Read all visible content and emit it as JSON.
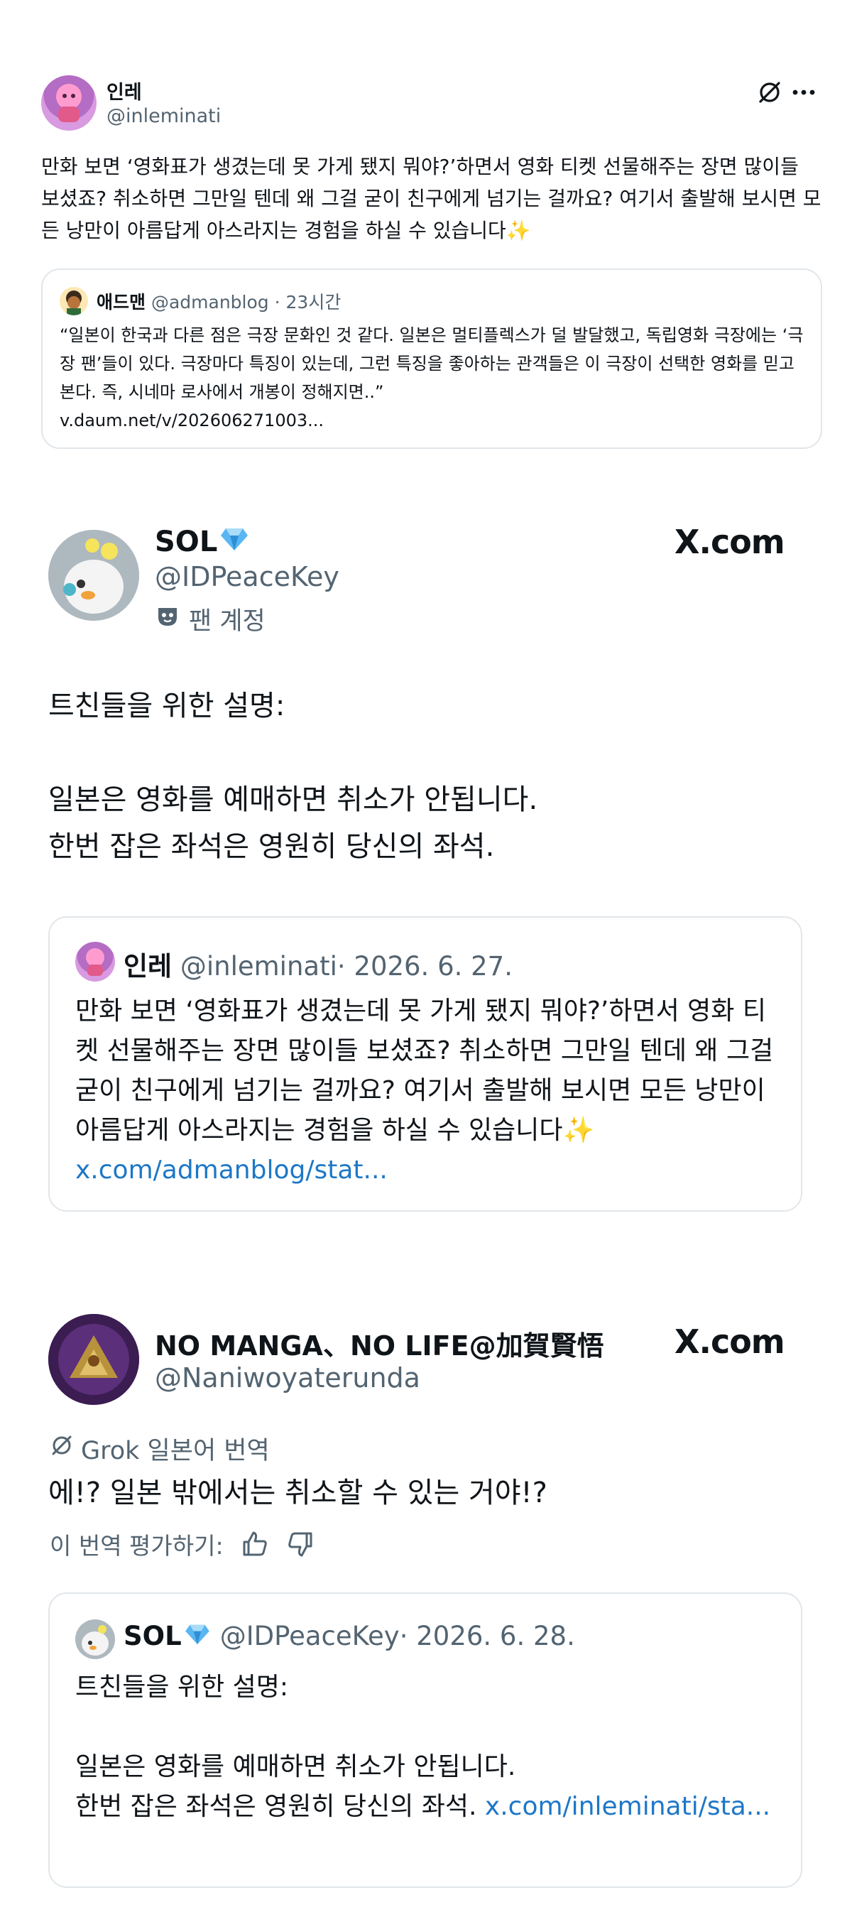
{
  "post1": {
    "name": "인레",
    "handle": "@inleminati",
    "body": "만화 보면 ‘영화표가 생겼는데 못 가게 됐지 뭐야?’하면서 영화 티켓 선물해주는 장면 많이들 보셨죠? 취소하면 그만일 텐데 왜 그걸 굳이 친구에게 넘기는 걸까요? 여기서 출발해 보시면 모든 낭만이 아름답게 아스라지는 경험을 하실 수 있습니다✨",
    "quote": {
      "name": "애드맨",
      "handle": "@admanblog",
      "time": "· 23시간",
      "text": "“일본이 한국과 다른 점은 극장 문화인 것 같다. 일본은 멀티플렉스가 덜 발달했고, 독립영화 극장에는 ‘극장 팬’들이 있다. 극장마다 특징이 있는데, 그런 특징을 좋아하는 관객들은 이 극장이 선택한 영화를 믿고 본다. 즉, 시네마 로사에서 개봉이 정해지면..”",
      "url": "v.daum.net/v/202606271003..."
    }
  },
  "post2": {
    "name": "SOL",
    "handle": "@IDPeaceKey",
    "badge": "팬 계정",
    "source": "X.com",
    "body_line1": "트친들을 위한 설명:",
    "body_line2": "일본은 영화를 예매하면 취소가 안됩니다.",
    "body_line3": "한번 잡은 좌석은 영원히 당신의 좌석.",
    "quote": {
      "name": "인레",
      "handle": "@inleminati",
      "date": "· 2026. 6. 27.",
      "text": "만화 보면 ‘영화표가 생겼는데 못 가게 됐지 뭐야?’하면서 영화 티켓 선물해주는 장면 많이들 보셨죠? 취소하면 그만일 텐데 왜 그걸 굳이 친구에게 넘기는 걸까요? 여기서 출발해 보시면 모든 낭만이 아름답게 아스라지는 경험을 하실 수 있습니다✨",
      "link": "x.com/admanblog/stat..."
    }
  },
  "post3": {
    "name": "NO MANGA、NO LIFE@加賀賢悟",
    "handle": "@Naniwoyaterunda",
    "source": "X.com",
    "translate_label": "Grok 일본어 번역",
    "body": "에!? 일본 밖에서는 취소할 수 있는 거야!?",
    "rate_label": "이 번역 평가하기:",
    "quote": {
      "name": "SOL",
      "handle": "@IDPeaceKey",
      "date": "· 2026. 6. 28.",
      "line1": "트친들을 위한 설명:",
      "line2": "일본은 영화를 예매하면 취소가 안됩니다.",
      "line3": "한번 잡은 좌석은 영원히 당신의 좌석.",
      "link": "x.com/inleminati/sta..."
    }
  },
  "colors": {
    "text": "#0f1419",
    "secondary": "#536471",
    "link": "#1d77c7",
    "border": "#e1e6ea",
    "verified_gem": "#3b9be6"
  },
  "icons": [
    "grok-icon",
    "more-icon",
    "gem-icon",
    "mask-icon",
    "thumbs-up-icon",
    "thumbs-down-icon"
  ]
}
